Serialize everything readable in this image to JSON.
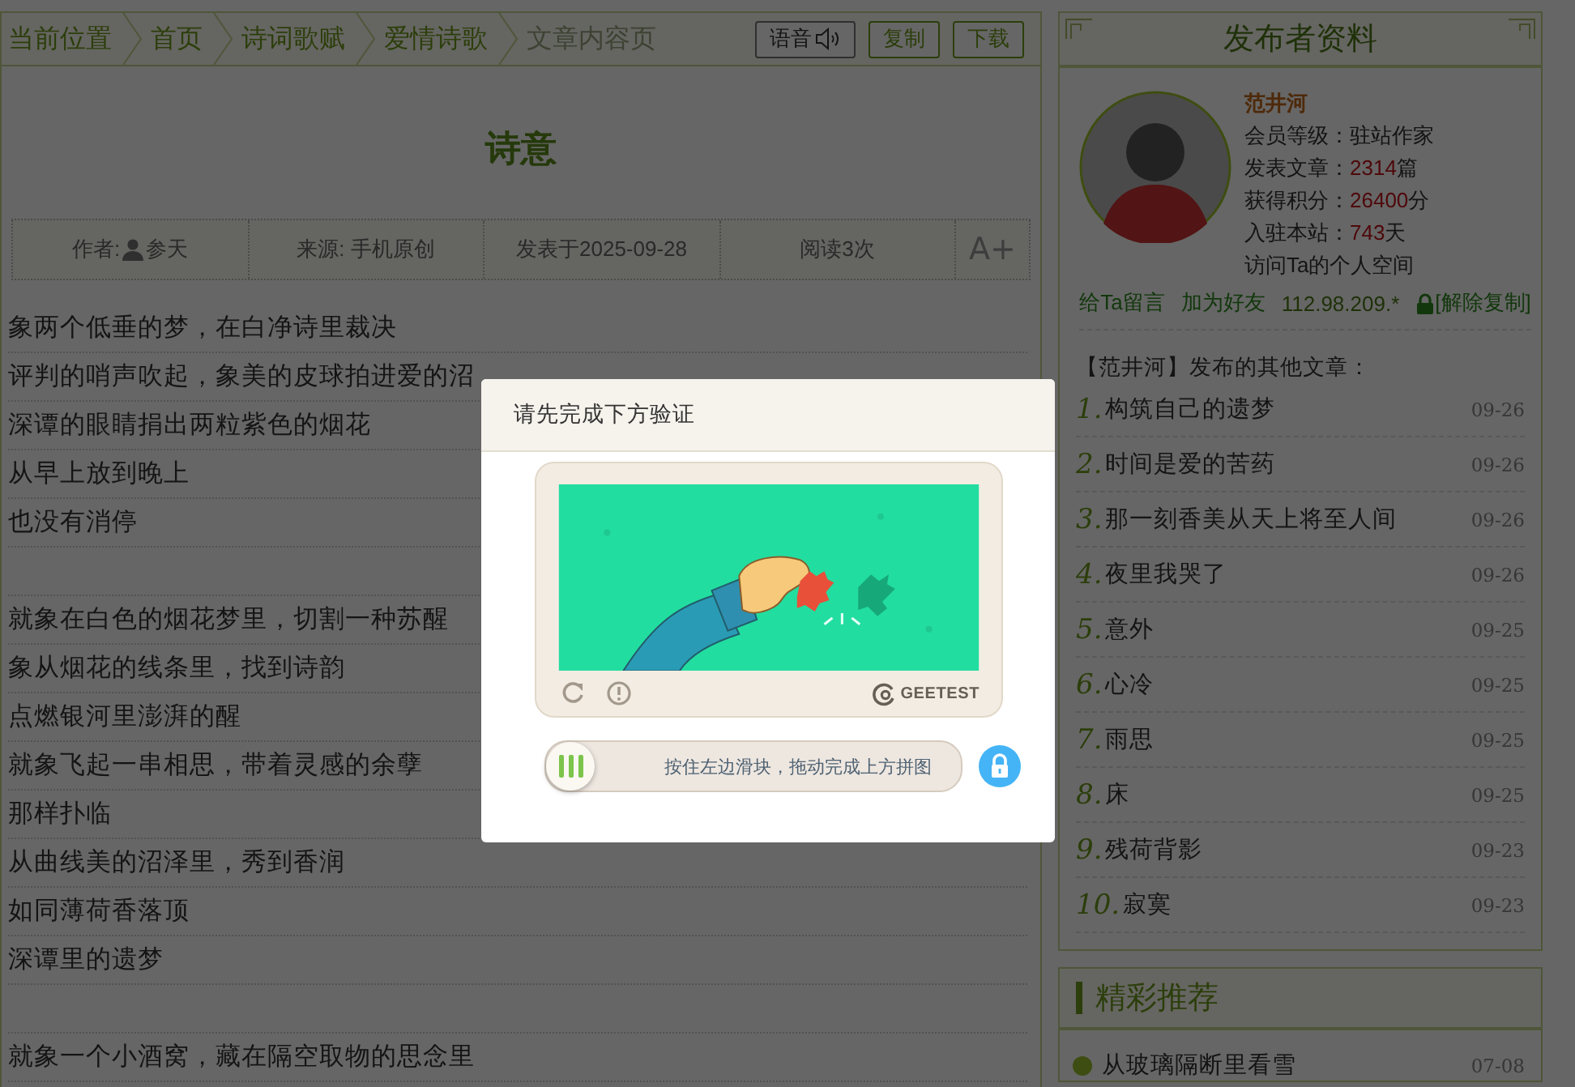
{
  "breadcrumb": {
    "items": [
      {
        "label": "当前位置",
        "kind": "link"
      },
      {
        "label": "首页",
        "kind": "link"
      },
      {
        "label": "诗词歌赋",
        "kind": "link"
      },
      {
        "label": "爱情诗歌",
        "kind": "link"
      },
      {
        "label": "文章内容页",
        "kind": "current"
      }
    ],
    "buttons": [
      {
        "label": "语音",
        "kind": "speech"
      },
      {
        "label": "复制",
        "kind": "plain"
      },
      {
        "label": "下载",
        "kind": "plain"
      }
    ]
  },
  "article": {
    "title": "诗意",
    "meta": [
      {
        "label": "作者:",
        "value": "参天",
        "kind": "author"
      },
      {
        "label": "来源: 手机原创",
        "kind": "text"
      },
      {
        "label": "发表于2025-09-28",
        "kind": "text"
      },
      {
        "label": "阅读3次",
        "kind": "text"
      },
      {
        "label": "A+",
        "kind": "button"
      }
    ],
    "stanzas": [
      [
        "象两个低垂的梦，在白净诗里裁决",
        "评判的哨声吹起，象美的皮球拍进爱的沼",
        "深谭的眼睛捐出两粒紫色的烟花",
        "从早上放到晚上",
        "也没有消停"
      ],
      [
        "就象在白色的烟花梦里，切割一种苏醒",
        "象从烟花的线条里，找到诗韵",
        "点燃银河里澎湃的醒",
        "就象飞起一串相思，带着灵感的余孽",
        "那样扑临",
        "从曲线美的沼泽里，秀到香润",
        "如同薄荷香落顶",
        "深谭里的遗梦"
      ],
      [
        "就象一个小酒窝，藏在隔空取物的思念里"
      ]
    ]
  },
  "publisher": {
    "title": "发布者资料",
    "name": "范井河",
    "stats": [
      {
        "label": "会员等级：驻站作家",
        "kind": "text"
      },
      {
        "label": "发表文章：",
        "value": "2314",
        "unit": "篇",
        "kind": "stat"
      },
      {
        "label": "获得积分：",
        "value": "26400",
        "unit": "分",
        "kind": "stat"
      },
      {
        "label": "入驻本站：",
        "value": "743",
        "unit": "天",
        "kind": "stat"
      },
      {
        "label": "访问Ta的个人空间",
        "kind": "link"
      }
    ],
    "links": [
      {
        "label": "给Ta留言",
        "kind": "link"
      },
      {
        "label": "加为好友",
        "kind": "link"
      },
      {
        "label": "112.98.209.*",
        "kind": "ip"
      },
      {
        "label": "[解除复制]",
        "kind": "lock"
      }
    ],
    "other_title": "【范井河】发布的其他文章：",
    "articles": [
      {
        "number": "1.",
        "title": "构筑自己的遗梦",
        "date": "09-26"
      },
      {
        "number": "2.",
        "title": "时间是爱的苦药",
        "date": "09-26"
      },
      {
        "number": "3.",
        "title": "那一刻香美从天上将至人间",
        "date": "09-26"
      },
      {
        "number": "4.",
        "title": "夜里我哭了",
        "date": "09-26"
      },
      {
        "number": "5.",
        "title": "意外",
        "date": "09-25"
      },
      {
        "number": "6.",
        "title": "心冷",
        "date": "09-25"
      },
      {
        "number": "7.",
        "title": "雨思",
        "date": "09-25"
      },
      {
        "number": "8.",
        "title": "床",
        "date": "09-25"
      },
      {
        "number": "9.",
        "title": "残荷背影",
        "date": "09-23"
      },
      {
        "number": "10.",
        "title": "寂寞",
        "date": "09-23"
      }
    ]
  },
  "recommend": {
    "title": "精彩推荐",
    "items": [
      {
        "title": "从玻璃隔断里看雪",
        "date": "07-08"
      }
    ]
  },
  "dialog": {
    "title": "请先完成下方验证",
    "brand": "GEETEST",
    "slider": {
      "hint": "按住左边滑块，拖动完成上方拼图"
    }
  }
}
